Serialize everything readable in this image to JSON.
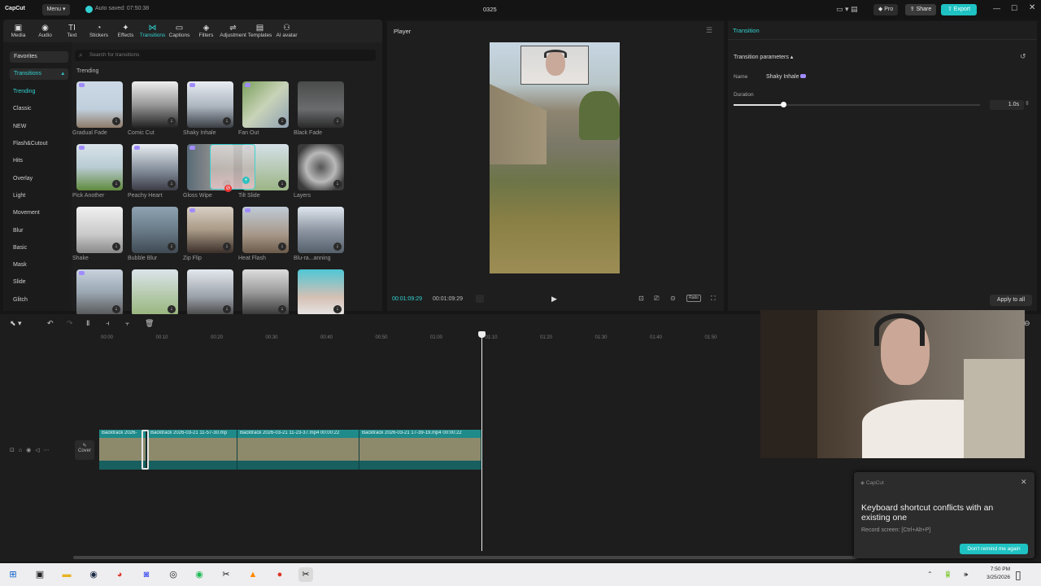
{
  "app": {
    "logo": "CapCut",
    "menu": "Menu",
    "autosave": "Auto saved: 07:50:38",
    "project": "0325",
    "pro": "Pro",
    "share": "Share",
    "export": "Export"
  },
  "tools": [
    {
      "label": "Media",
      "icon": "media-icon",
      "glyph": "▣"
    },
    {
      "label": "Audio",
      "icon": "audio-icon",
      "glyph": "◉"
    },
    {
      "label": "Text",
      "icon": "text-icon",
      "glyph": "TI"
    },
    {
      "label": "Stickers",
      "icon": "stickers-icon",
      "glyph": "◔"
    },
    {
      "label": "Effects",
      "icon": "effects-icon",
      "glyph": "✦"
    },
    {
      "label": "Transitions",
      "icon": "transitions-icon",
      "glyph": "⋈"
    },
    {
      "label": "Captions",
      "icon": "captions-icon",
      "glyph": "▭"
    },
    {
      "label": "Filters",
      "icon": "filters-icon",
      "glyph": "◈"
    },
    {
      "label": "Adjustment",
      "icon": "adjustment-icon",
      "glyph": "⇌"
    },
    {
      "label": "Templates",
      "icon": "templates-icon",
      "glyph": "▤"
    },
    {
      "label": "AI avatar",
      "icon": "ai-avatar-icon",
      "glyph": "⚇"
    }
  ],
  "sidebar": {
    "favorites": "Favorites",
    "transitions": "Transitions",
    "items": [
      "Trending",
      "Classic",
      "NEW",
      "Flash&Cutout",
      "Hits",
      "Overlay",
      "Light",
      "Movement",
      "Blur",
      "Basic",
      "Mask",
      "Slide",
      "Glitch"
    ]
  },
  "search": {
    "placeholder": "Search for transitions"
  },
  "section": "Trending",
  "effects": [
    "Gradual Fade",
    "Comic Cut",
    "Shaky Inhale",
    "Fan Out",
    "Black Fade",
    "Pick Another",
    "Peachy Heart",
    "Gloss Wipe",
    "Tilt Slide",
    "Layers",
    "Shake",
    "Bubble Blur",
    "Zip Flip",
    "Heat Flash",
    "Blu-ra...anning",
    "",
    "",
    "",
    "",
    ""
  ],
  "player": {
    "title": "Player",
    "current": "00:01:09:29",
    "total": "00:01:09:29",
    "ratio": "Ratio"
  },
  "transition": {
    "tab": "Transition",
    "params": "Transition parameters",
    "name_label": "Name",
    "name_value": "Shaky Inhale",
    "duration_label": "Duration",
    "duration_value": "1.0s",
    "duration_fraction": 0.2,
    "apply_all": "Apply to all"
  },
  "timeline": {
    "ruler": [
      "00:00",
      "00:10",
      "00:20",
      "00:30",
      "00:40",
      "00:50",
      "01:00",
      "01:10",
      "01:20",
      "01:30",
      "01:40",
      "01:50"
    ],
    "cover": "Cover",
    "clips": [
      {
        "label": "Backtrack 2026-"
      },
      {
        "label": "Backtrack 2026-03-21 11-57-30.mp"
      },
      {
        "label": "Backtrack 2026-03-21 11-23-37.mp4  00:00:22"
      },
      {
        "label": "Backtrack 2026-03-21 17-39-19.mp4  00:00:22"
      }
    ]
  },
  "toast": {
    "app": "CapCut",
    "message": "Keyboard shortcut conflicts with an existing one",
    "detail": "Record screen: [Ctrl+Alt+P]",
    "button": "Don't remind me again"
  },
  "taskbar": {
    "time": "7:50 PM",
    "date": "3/25/2026"
  },
  "colors": {
    "accent": "#33d1d1",
    "export": "#1fc2c2",
    "clip": "#1f8a8a"
  }
}
